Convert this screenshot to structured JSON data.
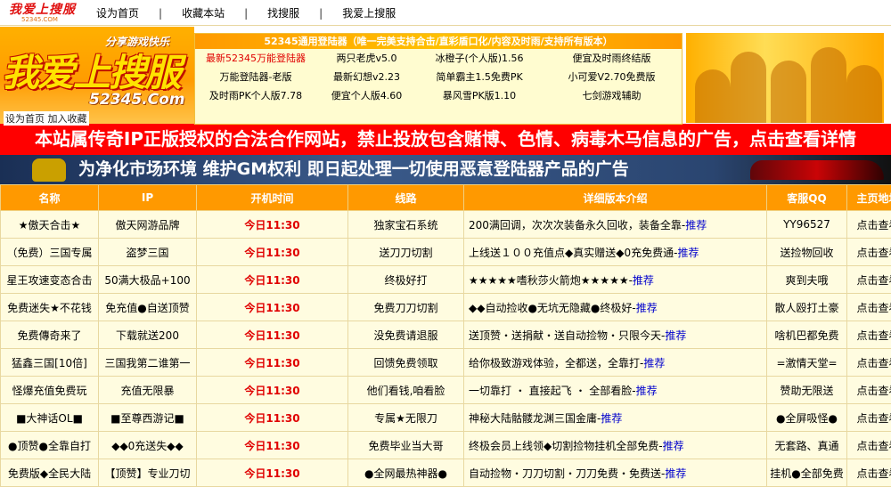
{
  "topnav": {
    "logo_text": "我爱上搜服",
    "logo_domain": "52345.COM",
    "items": [
      "设为首页",
      "收藏本站",
      "找搜服",
      "我爱上搜服"
    ]
  },
  "header": {
    "slogan": "分享游戏快乐",
    "logo_big": "我爱上搜服",
    "domain": "52345.Com",
    "links": [
      "设为首页",
      "加入收藏"
    ],
    "downloader_title": "52345通用登陆器（唯一完美支持合击/直彩盾口化/内容及时雨/支持所有版本）",
    "downloads": [
      "最新52345万能登陆器",
      "两只老虎v5.0",
      "冰橙子(个人版)1.56",
      "便宜及时雨终结版",
      "万能登陆器-老版",
      "最新幻想v2.23",
      "简单霸主1.5免费PK",
      "小可爱V2.70免费版",
      "及时雨PK个人版7.78",
      "便宜个人版4.60",
      "暴风雪PK版1.10",
      "七剑游戏辅助"
    ]
  },
  "notice_text": "本站属传奇IP正版授权的合法合作网站，禁止投放包含赌博、色情、病毒木马信息的广告，点击查看详情",
  "gm_banner_text": "为净化市场环境  维护GM权利  即日起处理一切使用恶意登陆器产品的广告",
  "table": {
    "headers": [
      "名称",
      "IP",
      "开机时间",
      "线路",
      "详细版本介绍",
      "客服QQ",
      "主页地址"
    ],
    "recommend_label": "推荐",
    "rows": [
      {
        "name": "★傲天合击★",
        "ip": "傲天网游品牌",
        "time": "今日11:30",
        "line": "独家宝石系统",
        "intro": "200满回调，次次次装备永久回收，装备全靠-",
        "qq": "YY96527",
        "home": "点击查看"
      },
      {
        "name": "（免费）三国专属",
        "ip": "盗梦三国",
        "time": "今日11:30",
        "line": "送刀刀切割",
        "intro": "上线送１００充值点◆真实赠送◆0充免费通-",
        "qq": "送捡物回收",
        "home": "点击查看"
      },
      {
        "name": "星王攻速变态合击",
        "ip": "50满大极品+100",
        "time": "今日11:30",
        "line": "终极好打",
        "intro": "★★★★★嗜秋莎火箭炮★★★★★-",
        "qq": "爽到夫哦",
        "home": "点击查看"
      },
      {
        "name": "免费迷失★不花钱",
        "ip": "免充值●自送顶赞",
        "time": "今日11:30",
        "line": "免费刀刀切割",
        "intro": "◆◆自动捡收●无坑无隐藏●终极好-",
        "qq": "散人殴打土豪",
        "home": "点击查看"
      },
      {
        "name": "免费傳奇来了",
        "ip": "下载就送200",
        "time": "今日11:30",
        "line": "没免费请退服",
        "intro": "送顶赞・送捐献・送自动捡物・只限今天-",
        "qq": "啥机巴都免费",
        "home": "点击查看"
      },
      {
        "name": "猛鑫三国[10倍]",
        "ip": "三国我第二谁第一",
        "time": "今日11:30",
        "line": "回馈免费领取",
        "intro": "给你极致游戏体验，全都送，全靠打-",
        "qq": "=激情天堂=",
        "home": "点击查看"
      },
      {
        "name": "怪爆充值免费玩",
        "ip": "充值无限暴",
        "time": "今日11:30",
        "line": "他们看钱,咱看脸",
        "intro": "一切靠打  ・ 直接起飞  ・ 全部看脸-",
        "qq": "赞助无限送",
        "home": "点击查看"
      },
      {
        "name": "■大神话OL■",
        "ip": "■至尊西游记■",
        "time": "今日11:30",
        "line": "专属★无限刀",
        "intro": "神秘大陆骷髅龙渊三国金庸-",
        "qq": "●全屏吸怪●",
        "home": "点击查看"
      },
      {
        "name": "●顶赞●全靠自打",
        "ip": "◆◆0充送失◆◆",
        "time": "今日11:30",
        "line": "免费毕业当大哥",
        "intro": "终极会员上线领◆切割捡物挂机全部免费-",
        "qq": "无套路、真通",
        "home": "点击查看"
      },
      {
        "name": "免费版◆全民大陆",
        "ip": "【顶赞】专业刀切",
        "time": "今日11:30",
        "line": "●全网最热神器●",
        "intro": "自动捡物・刀刀切割・刀刀免费・免费送-",
        "qq": "挂机●全部免费",
        "home": "点击查看"
      }
    ]
  },
  "colors": {
    "header_orange": "#ff9900",
    "notice_red": "#ff0000",
    "time_red": "#e00000",
    "recommend_blue": "#0000cc",
    "row_bg": "#fffce0"
  }
}
